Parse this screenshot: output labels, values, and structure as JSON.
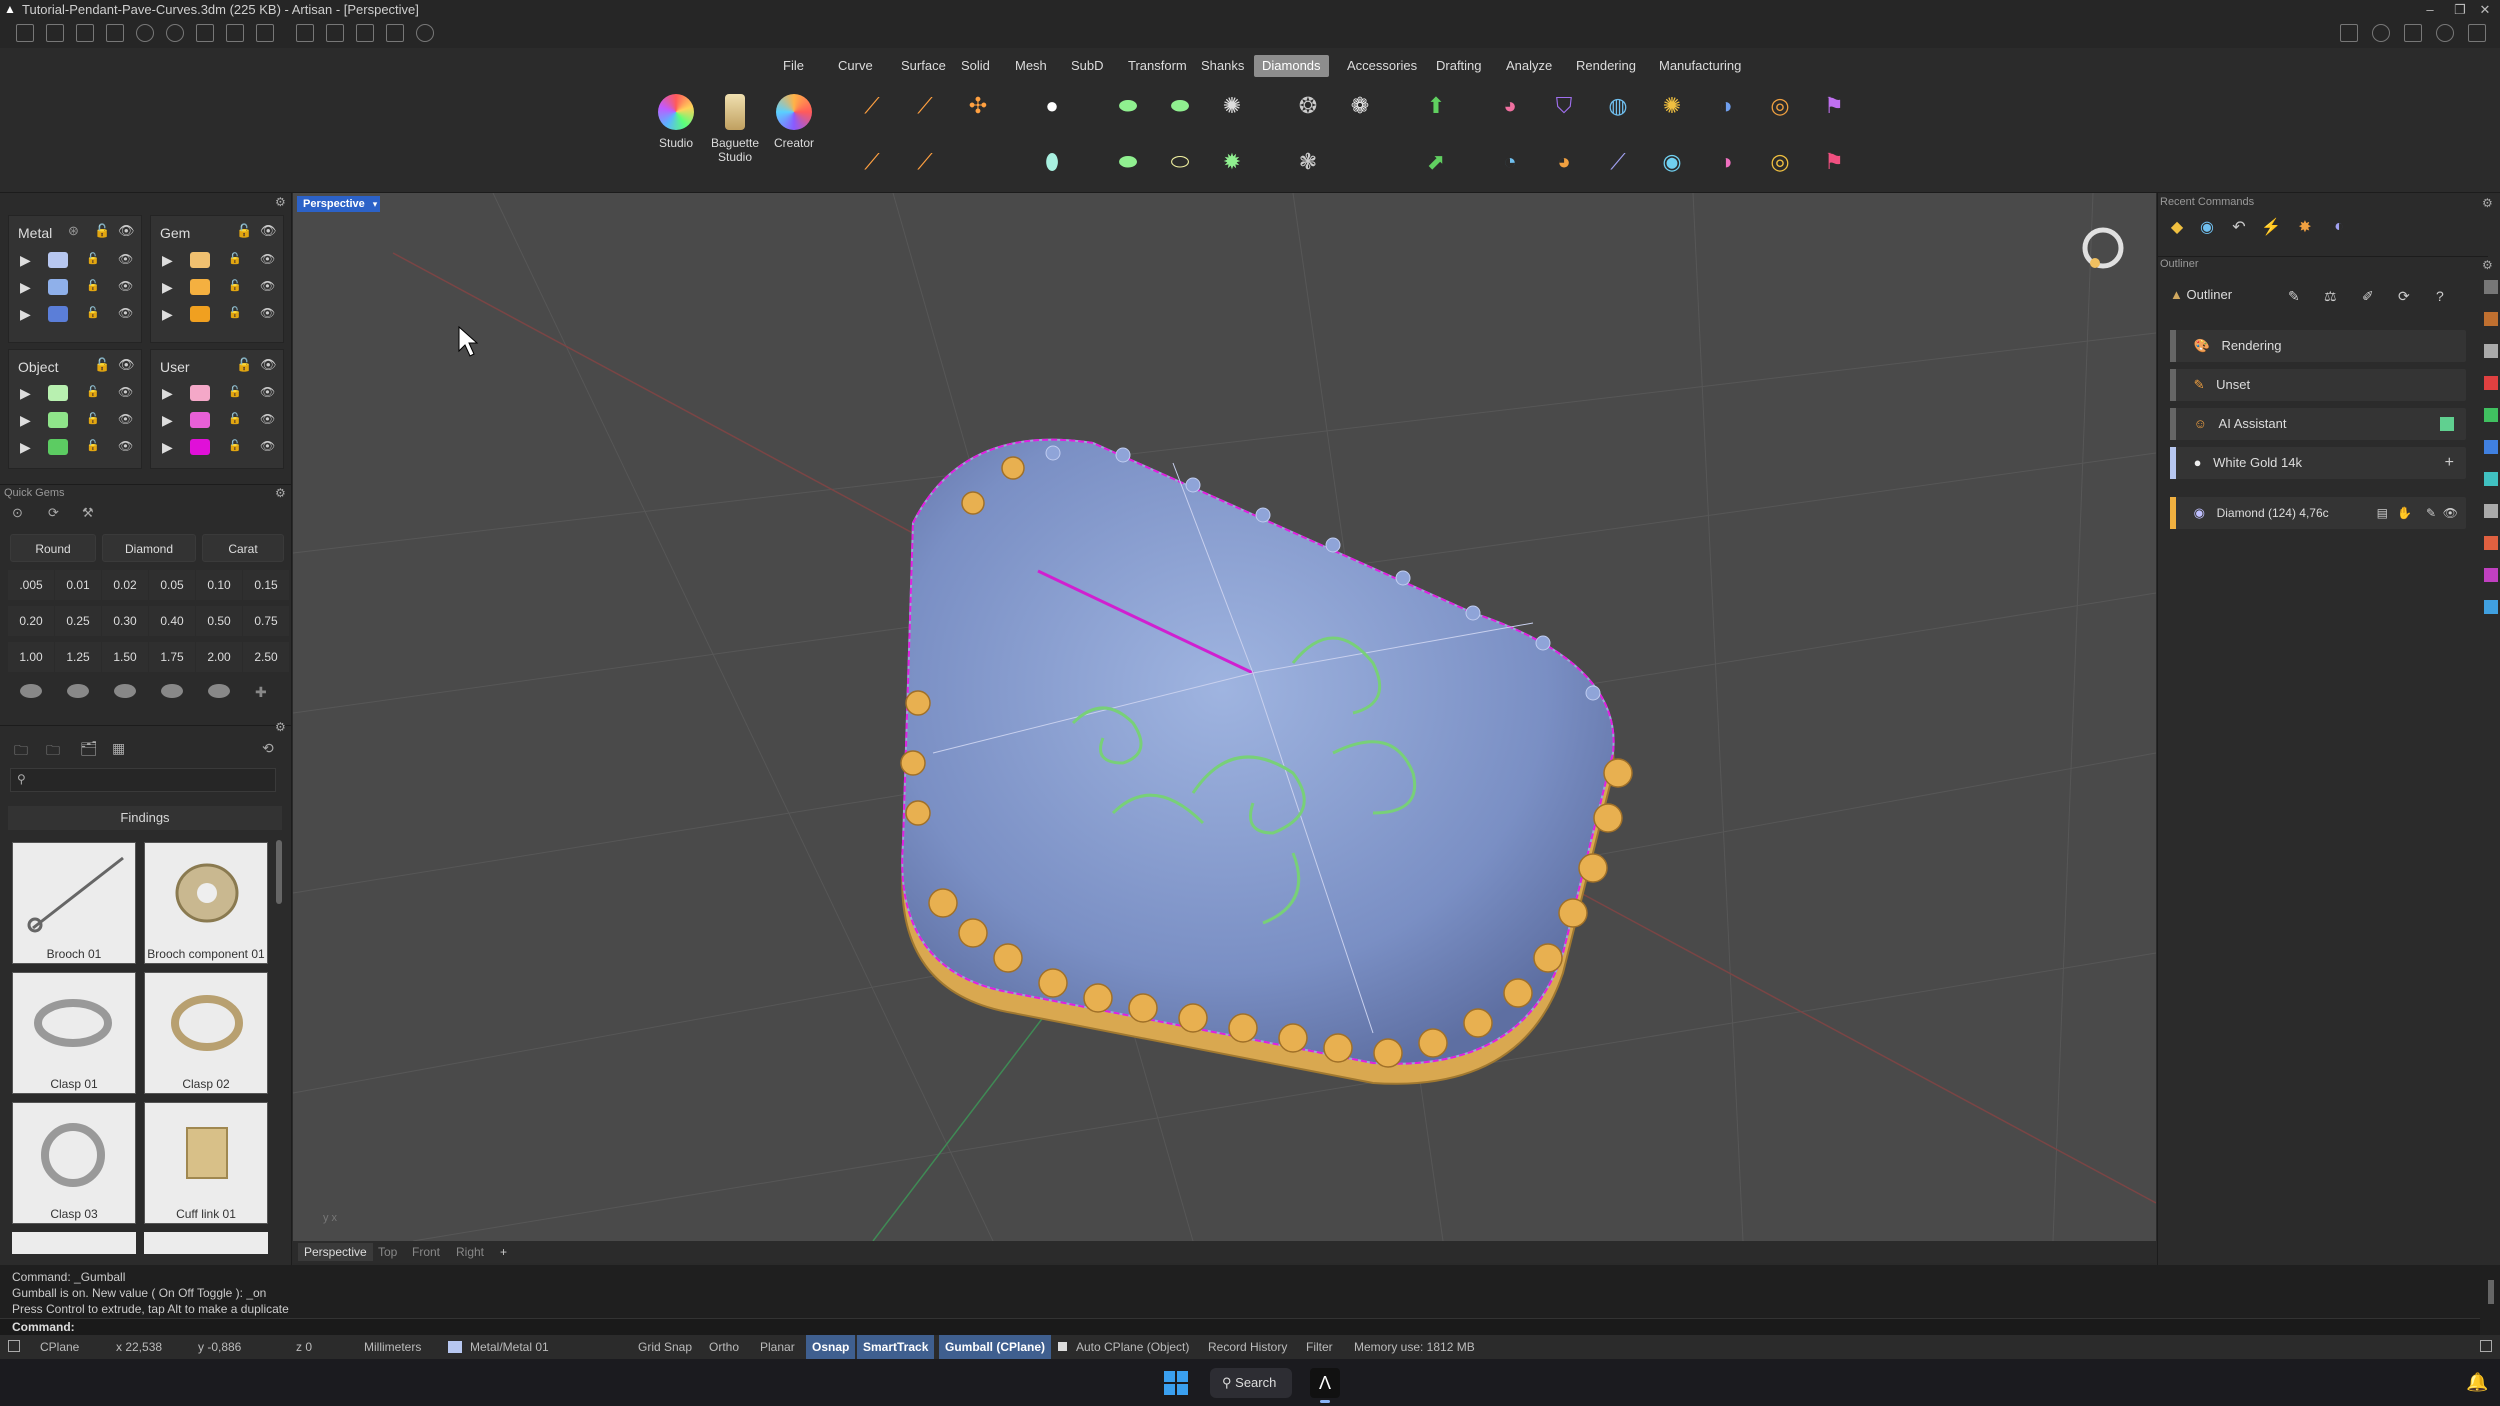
{
  "window": {
    "title": "Tutorial-Pendant-Pave-Curves.3dm (225 KB) - Artisan - [Perspective]"
  },
  "menu": [
    "File",
    "Curve",
    "Surface",
    "Solid",
    "Mesh",
    "SubD",
    "Transform",
    "Shanks",
    "Diamonds",
    "Accessories",
    "Drafting",
    "Analyze",
    "Rendering",
    "Manufacturing"
  ],
  "menu_active": "Diamonds",
  "ribbon_tools": [
    {
      "label1": "Studio",
      "label2": ""
    },
    {
      "label1": "Baguette",
      "label2": "Studio"
    },
    {
      "label1": "Creator",
      "label2": ""
    }
  ],
  "layers": {
    "metal_title": "Metal",
    "gem_title": "Gem",
    "object_title": "Object",
    "user_title": "User",
    "metal_colors": [
      "#b7c7f0",
      "#8fb0ea",
      "#5b7ed8"
    ],
    "gem_colors": [
      "#f0c070",
      "#f4b040",
      "#f0a020"
    ],
    "object_colors": [
      "#b8f0b0",
      "#8fe48a",
      "#5ccc62"
    ],
    "user_colors": [
      "#f4a8c8",
      "#e860d8",
      "#e010d8"
    ]
  },
  "quick_gems": {
    "title": "Quick Gems",
    "shape": "Round",
    "material": "Diamond",
    "unit": "Carat",
    "values": [
      ".005",
      "0.01",
      "0.02",
      "0.05",
      "0.10",
      "0.15",
      "0.20",
      "0.25",
      "0.30",
      "0.40",
      "0.50",
      "0.75",
      "1.00",
      "1.25",
      "1.50",
      "1.75",
      "2.00",
      "2.50"
    ]
  },
  "findings": {
    "title": "Findings",
    "items": [
      "Brooch 01",
      "Brooch component 01",
      "Clasp 01",
      "Clasp 02",
      "Clasp 03",
      "Cuff link 01"
    ]
  },
  "viewport": {
    "name": "Perspective",
    "tabs": [
      "Perspective",
      "Top",
      "Front",
      "Right"
    ],
    "add_tab": "+"
  },
  "right": {
    "recent_title": "Recent Commands",
    "outliner_section": "Outliner",
    "outliner_tab": "Outliner",
    "rows": [
      "Rendering",
      "Unset",
      "AI Assistant",
      "White Gold 14k"
    ],
    "diamond_row": "Diamond (124) 4,76c"
  },
  "command": {
    "lines": [
      "Command: _Gumball",
      "Gumball is on. New value ( On  Off  Toggle ): _on",
      "Press Control to extrude, tap Alt to make a duplicate"
    ],
    "prompt": "Command:"
  },
  "status": {
    "cplane": "CPlane",
    "x": "x 22,538",
    "y": "y -0,886",
    "z": "z 0",
    "units": "Millimeters",
    "layer": "Metal/Metal 01",
    "grid_snap": "Grid Snap",
    "ortho": "Ortho",
    "planar": "Planar",
    "osnap": "Osnap",
    "smarttrack": "SmartTrack",
    "gumball": "Gumball (CPlane)",
    "auto_cplane": "Auto CPlane (Object)",
    "record_history": "Record History",
    "filter": "Filter",
    "memory": "Memory use: 1812 MB"
  },
  "taskbar": {
    "search": "Search"
  }
}
